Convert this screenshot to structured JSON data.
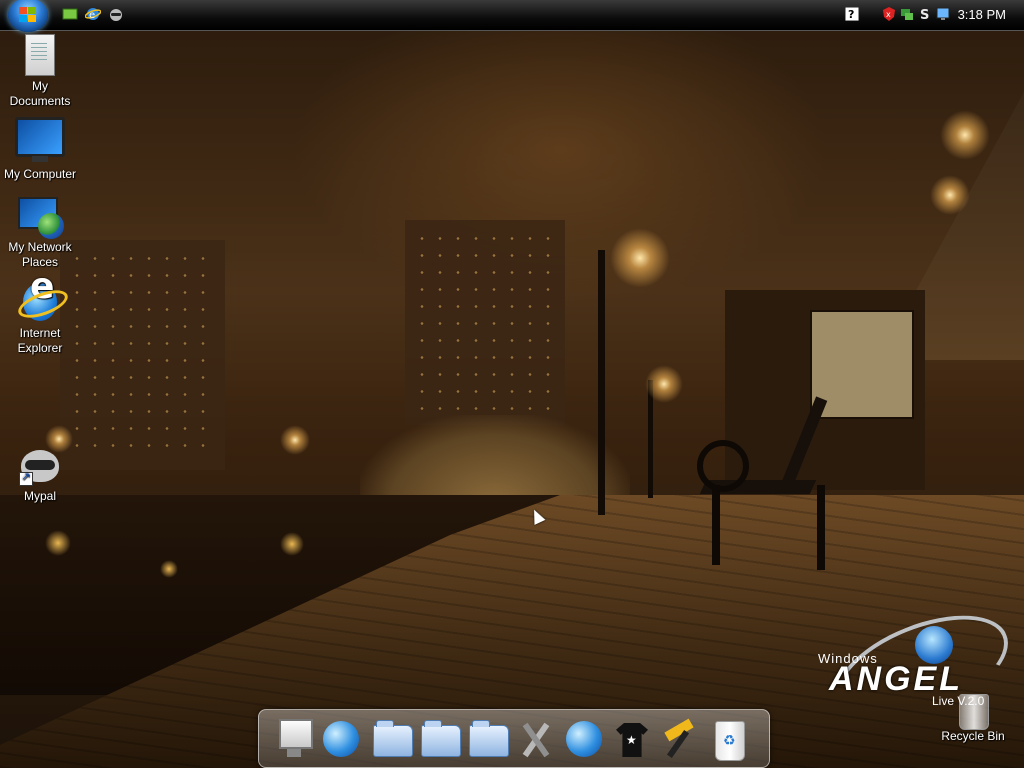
{
  "taskbar": {
    "start_button_icon": "windows-orb-icon",
    "quick_launch": [
      {
        "name": "show-desktop-icon"
      },
      {
        "name": "internet-explorer-icon"
      },
      {
        "name": "mypal-icon"
      }
    ],
    "tray": [
      {
        "name": "help-icon"
      },
      {
        "name": "security-shield-icon"
      },
      {
        "name": "network-icon"
      },
      {
        "name": "sound-icon"
      },
      {
        "name": "display-icon"
      }
    ],
    "clock": "3:18 PM"
  },
  "desktop_icons": [
    {
      "label": "My Documents",
      "icon": "my-documents-icon"
    },
    {
      "label": "My Computer",
      "icon": "my-computer-icon"
    },
    {
      "label": "My Network Places",
      "icon": "network-places-icon"
    },
    {
      "label": "Internet Explorer",
      "icon": "internet-explorer-icon"
    },
    {
      "label": "Mypal",
      "icon": "mypal-raccoon-icon"
    },
    {
      "label": "Recycle Bin",
      "icon": "recycle-bin-icon"
    }
  ],
  "brand": {
    "windows": "Windows",
    "angel": "ANGEL",
    "live": "Live V.2.0"
  },
  "dock": [
    {
      "name": "my-computer-dock-icon"
    },
    {
      "name": "internet-dock-icon"
    },
    {
      "name": "documents-folder-dock-icon"
    },
    {
      "name": "music-folder-dock-icon"
    },
    {
      "name": "pictures-folder-dock-icon"
    },
    {
      "name": "tools-dock-icon"
    },
    {
      "name": "network-globe-dock-icon"
    },
    {
      "name": "themes-shirt-dock-icon"
    },
    {
      "name": "settings-hammer-dock-icon"
    },
    {
      "name": "recycle-bin-dock-icon"
    }
  ],
  "colors": {
    "taskbar": "#0c0c0c",
    "clock_text": "#ffffff",
    "wallpaper_tone": "#4b3118"
  }
}
